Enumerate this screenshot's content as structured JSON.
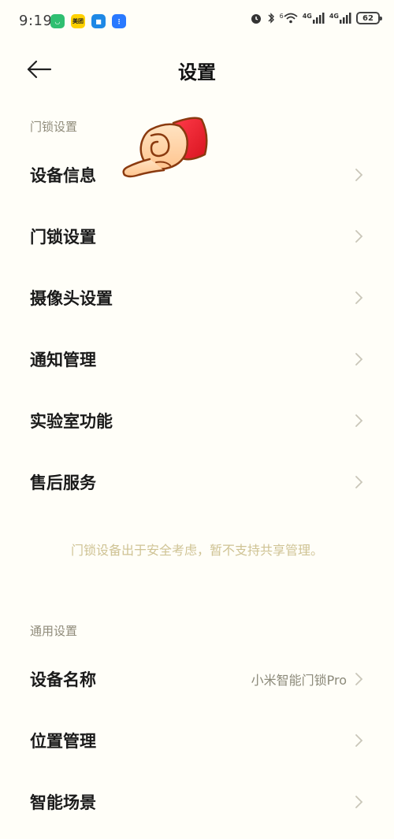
{
  "status_bar": {
    "time": "9:19",
    "app_icons": [
      {
        "name": "mijia-icon",
        "color": "#2fbf71",
        "glyph": "◡"
      },
      {
        "name": "meituan-icon",
        "color": "#ffd100",
        "glyph": "美团"
      },
      {
        "name": "robot-app-icon",
        "color": "#1e88e5",
        "glyph": "■"
      },
      {
        "name": "voice-app-icon",
        "color": "#2979ff",
        "glyph": "⋮"
      }
    ],
    "network_1": "4G",
    "network_2": "4G",
    "wifi_badge": "6",
    "battery": "62"
  },
  "header": {
    "title": "设置"
  },
  "sections": {
    "lock_settings_header": "门锁设置",
    "general_settings_header": "通用设置"
  },
  "lock_items": [
    {
      "label": "设备信息"
    },
    {
      "label": "门锁设置"
    },
    {
      "label": "摄像头设置"
    },
    {
      "label": "通知管理"
    },
    {
      "label": "实验室功能"
    },
    {
      "label": "售后服务"
    }
  ],
  "notice": "门锁设备出于安全考虑，暂不支持共享管理。",
  "general_items": [
    {
      "label": "设备名称",
      "value": "小米智能门锁Pro"
    },
    {
      "label": "位置管理"
    },
    {
      "label": "智能场景"
    }
  ],
  "colors": {
    "background": "#fffef8",
    "section_text": "#8f8b7a",
    "notice_text": "#cfc394",
    "chevron": "#c9c6b8"
  }
}
